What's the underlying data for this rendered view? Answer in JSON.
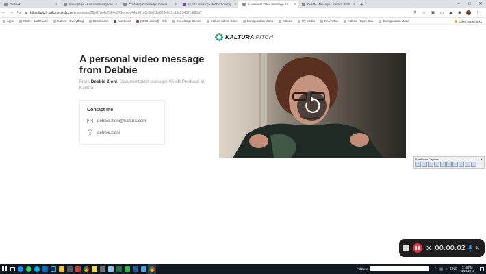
{
  "browser": {
    "tabs": [
      {
        "title": "GitBook",
        "active": false
      },
      {
        "title": "Initial page - Kaltura Manageme",
        "active": false
      },
      {
        "title": "Content | Knowledge Center",
        "active": false
      },
      {
        "title": "(5,573 unread) - debbiezioni@y",
        "active": false
      },
      {
        "title": "A personal video message fro",
        "active": true
      },
      {
        "title": "Create Message - Kaltura Pitch",
        "active": false
      }
    ],
    "url_host": "https://pitch.kaltura-pitch.com",
    "url_path": "/message/28e87ce4c7364d671ecada44a501c6c0b011a809eb17c19c23407fc690d7",
    "bookmarks": [
      "Apps",
      "KMC > dashboard",
      "Kaltura - Everything",
      "Dashboard",
      "Facebook",
      "(3803 unread) - deb",
      "Knowledge Center",
      "Kaltura Admin Cons",
      "Configuration Mana",
      "Kaltura",
      "My Media",
      "KALTURA",
      "Kaltura - Open Sou",
      "Configuration Mana"
    ],
    "other_bookmarks": "Other bookmarks"
  },
  "page": {
    "logo_bold": "KALTURA",
    "logo_light": "PITCH",
    "title": "A personal video message from Debbie",
    "from_prefix": "From",
    "from_name": "Debbie Zioni",
    "from_role": ", Documentation Manager VAMB Products at Kaltura",
    "contact_heading": "Contact me",
    "contact_email": "debbie.zioni@kaltura.com",
    "contact_skype": "debbie.zioni"
  },
  "faststone": {
    "title": "FastStone Capture"
  },
  "recorder": {
    "timer": "00:00:02"
  },
  "taskbar": {
    "address_label": "Address",
    "lang": "ENG",
    "time": "3:16 PM",
    "date": "11/26/2018"
  },
  "colors": {
    "kaltura_green": "#2da04a",
    "kaltura_teal": "#1aa0b5",
    "rec_red": "#e0313f"
  }
}
